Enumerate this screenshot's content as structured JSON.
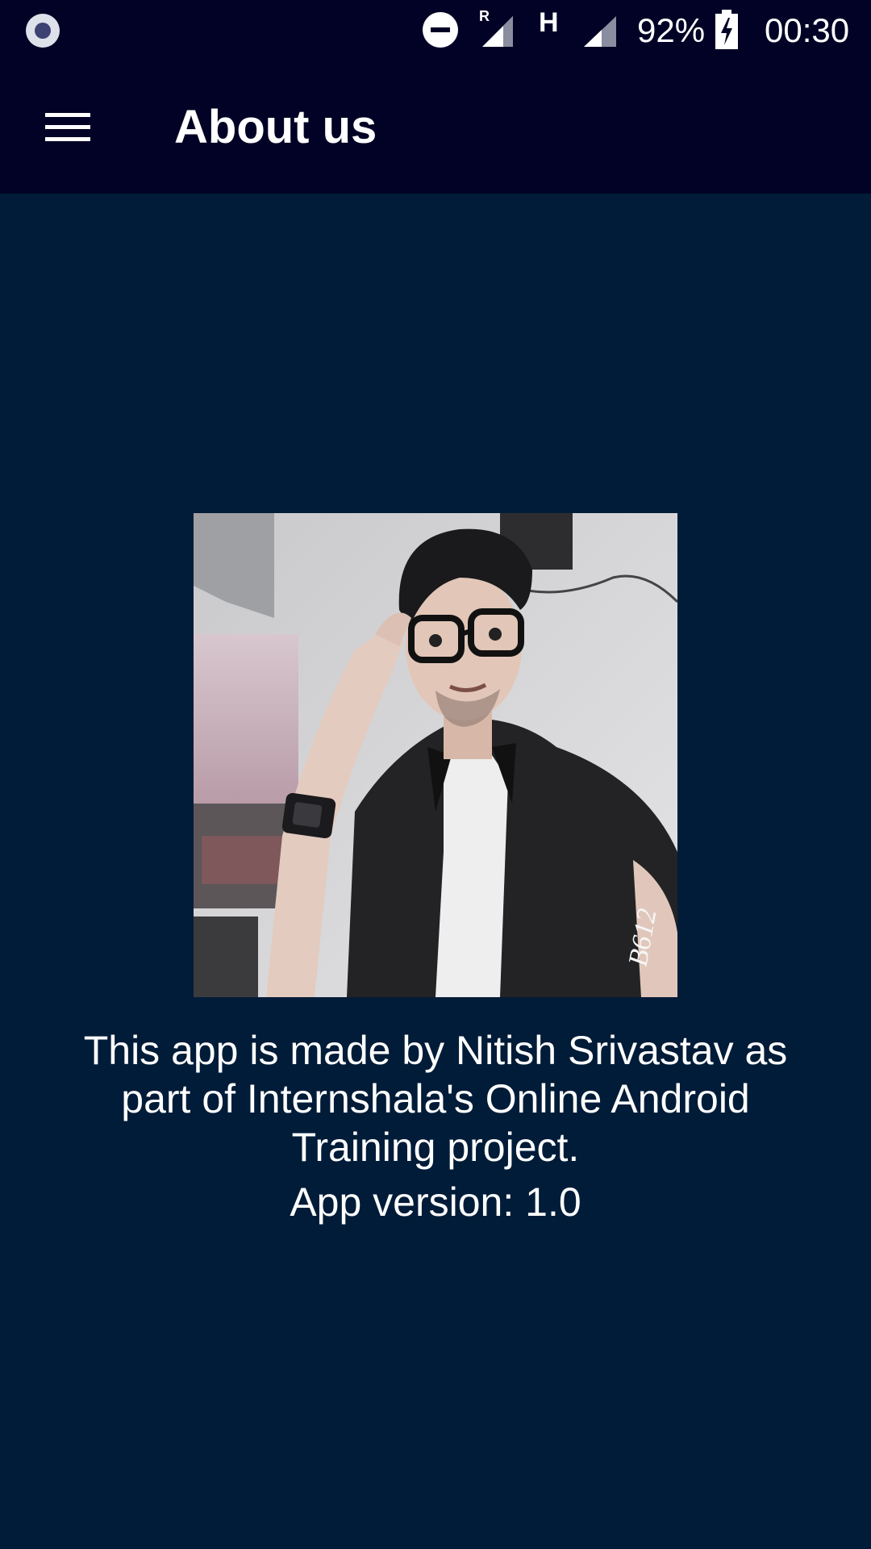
{
  "status_bar": {
    "network_type": "H",
    "roaming_label": "R",
    "battery_percent": "92%",
    "time": "00:30",
    "icons": [
      "screen-record-icon",
      "do-not-disturb-icon",
      "signal-roaming-icon",
      "signal-icon",
      "battery-charging-icon"
    ]
  },
  "toolbar": {
    "title": "About us",
    "menu_icon": "hamburger-menu-icon"
  },
  "content": {
    "photo_watermark": "B612",
    "description": "This app is made by Nitish Srivastav as part of Internshala's Online Android Training project.",
    "version": "App version: 1.0"
  },
  "colors": {
    "background": "#011c38",
    "toolbar": "#010225",
    "text": "#ffffff"
  }
}
